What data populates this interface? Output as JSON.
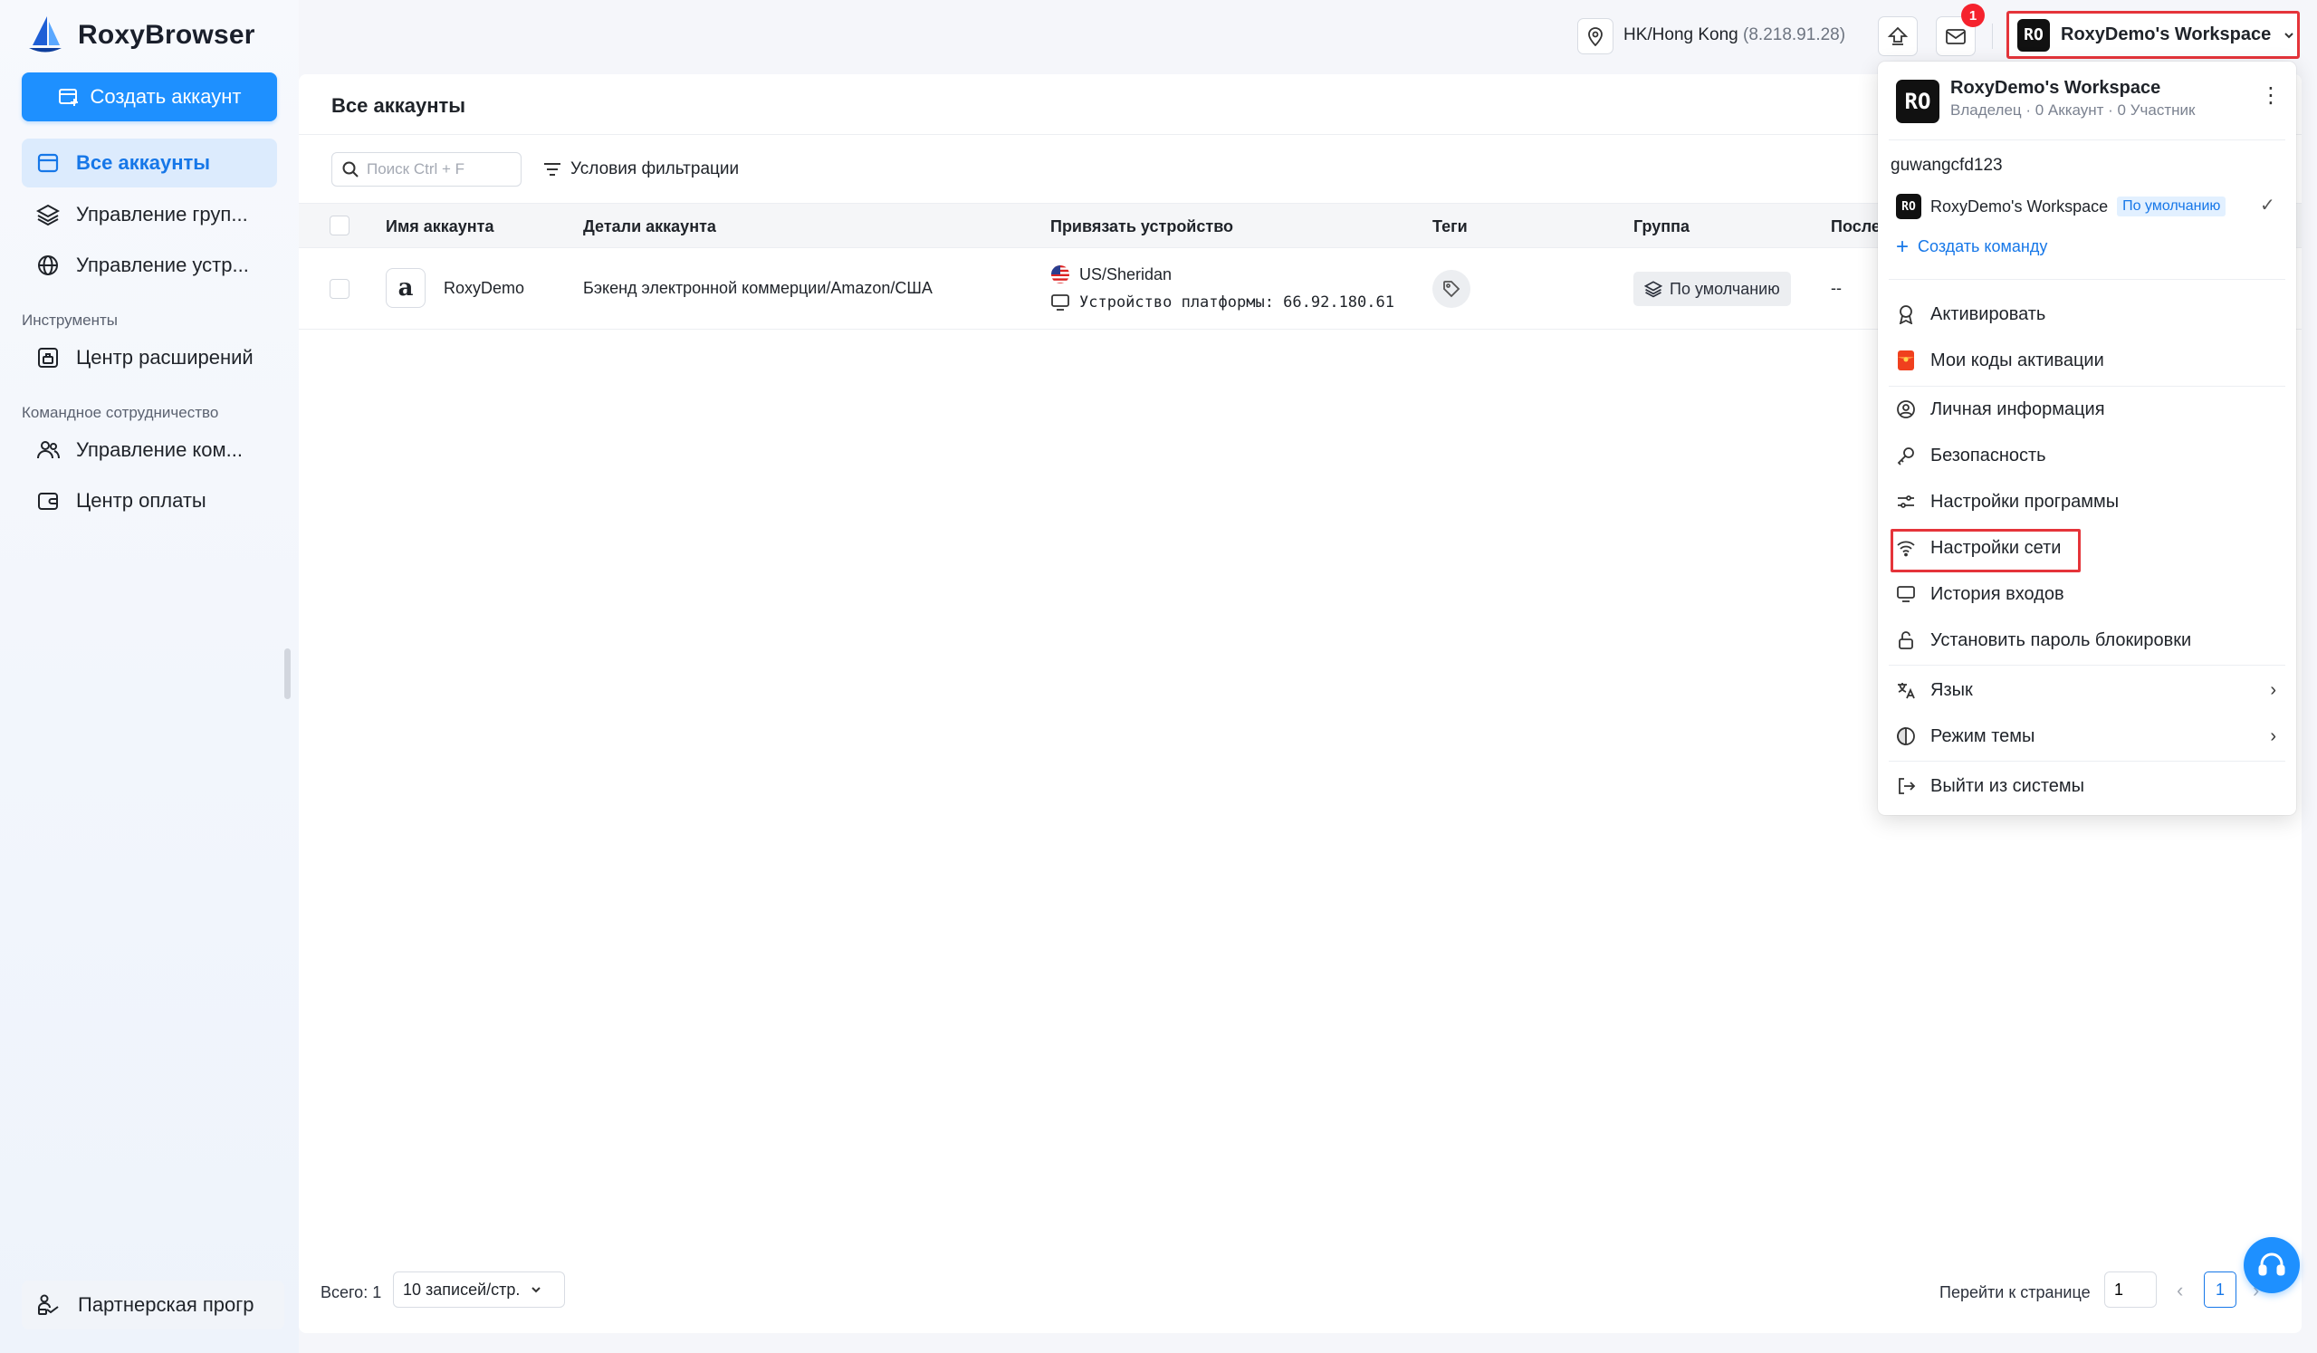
{
  "app": {
    "name": "RoxyBrowser"
  },
  "sidebar": {
    "create_button": "Создать аккаунт",
    "nav": [
      {
        "label": "Все аккаунты",
        "icon": "window-icon",
        "active": true
      },
      {
        "label": "Управление груп...",
        "icon": "layers-icon"
      },
      {
        "label": "Управление устр...",
        "icon": "globe-icon"
      }
    ],
    "tools_label": "Инструменты",
    "tools": [
      {
        "label": "Центр расширений",
        "icon": "extension-icon"
      }
    ],
    "team_label": "Командное сотрудничество",
    "team": [
      {
        "label": "Управление ком...",
        "icon": "users-icon"
      },
      {
        "label": "Центр оплаты",
        "icon": "wallet-icon"
      }
    ],
    "partner": "Партнерская прогр"
  },
  "topbar": {
    "location": "HK/Hong Kong",
    "ip": "(8.218.91.28)",
    "notifications": "1",
    "workspace_avatar": "RO",
    "workspace_name": "RoxyDemo's Workspace"
  },
  "main": {
    "title": "Все аккаунты",
    "search_placeholder": "Поиск Ctrl + F",
    "filter_label": "Условия фильтрации",
    "columns": [
      "Имя аккаунта",
      "Детали аккаунта",
      "Привязать устройство",
      "Теги",
      "Группа",
      "После"
    ],
    "rows": [
      {
        "name": "RoxyDemo",
        "platform_icon": "amazon-icon",
        "details": "Бэкенд электронной коммерции/Amazon/США",
        "device_location": "US/Sheridan",
        "device_platform": "Устройство платформы: 66.92.180.61",
        "group": "По умолчанию",
        "last": "--"
      }
    ],
    "footer": {
      "total": "Всего: 1",
      "page_size": "10 записей/стр.",
      "goto_label": "Перейти к странице",
      "goto_value": "1",
      "current_page": "1"
    }
  },
  "dropdown": {
    "ws_avatar": "RO",
    "ws_name": "RoxyDemo's Workspace",
    "ws_meta": "Владелец · 0 Аккаунт · 0 Участник",
    "username": "guwangcfd123",
    "team_avatar": "RO",
    "team_name": "RoxyDemo's Workspace",
    "team_default": "По умолчанию",
    "create_team": "Создать команду",
    "items": {
      "activate": "Активировать",
      "codes": "Мои коды активации",
      "profile": "Личная информация",
      "security": "Безопасность",
      "app_settings": "Настройки программы",
      "network": "Настройки сети",
      "login_history": "История входов",
      "lock_password": "Установить пароль блокировки",
      "language": "Язык",
      "theme": "Режим темы",
      "logout": "Выйти из системы"
    }
  },
  "colors": {
    "accent": "#1e90ff",
    "highlight": "#e5343a",
    "active_bg": "#dcebfd"
  }
}
